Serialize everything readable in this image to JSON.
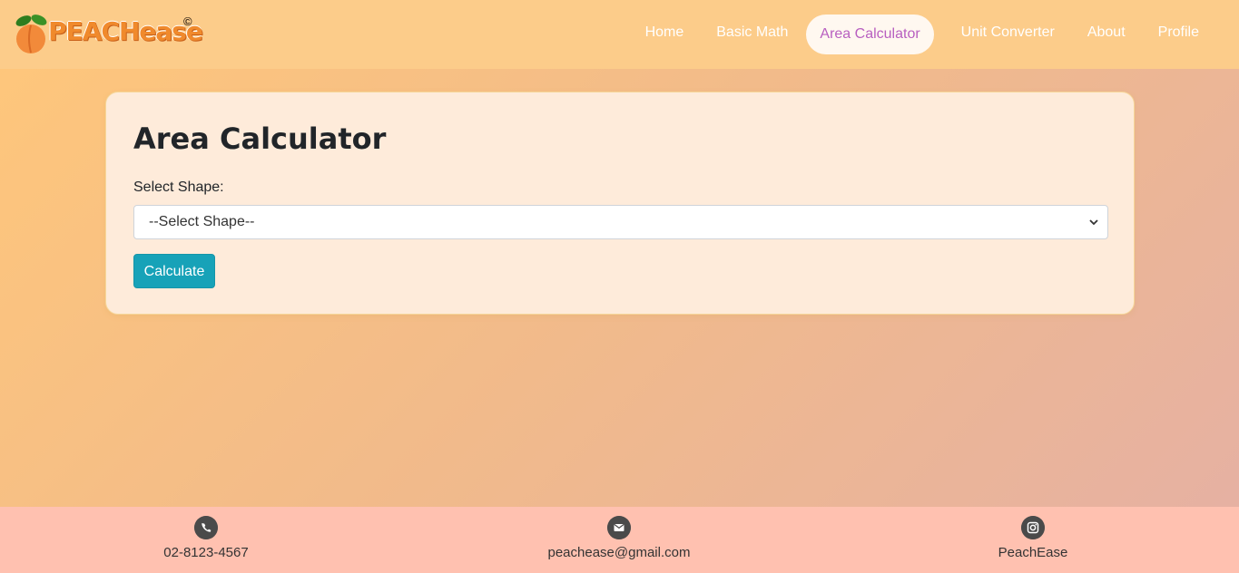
{
  "brand": {
    "name": "PEACHease",
    "copyright_mark": "©"
  },
  "nav": {
    "items": [
      {
        "label": "Home"
      },
      {
        "label": "Basic Math"
      },
      {
        "label": "Area Calculator"
      },
      {
        "label": "Unit Converter"
      },
      {
        "label": "About"
      },
      {
        "label": "Profile"
      }
    ],
    "active": "Area Calculator"
  },
  "main": {
    "title": "Area Calculator",
    "shape_label": "Select Shape:",
    "shape_select_value": "--Select Shape--",
    "calculate_label": "Calculate"
  },
  "footer": {
    "phone": {
      "icon": "phone-icon",
      "text": "02-8123-4567"
    },
    "email": {
      "icon": "mail-icon",
      "text": "peachease@gmail.com"
    },
    "instagram": {
      "icon": "instagram-icon",
      "text": "PeachEase"
    }
  },
  "colors": {
    "nav_bg": "#fccc8a",
    "active_text": "#b85fc0",
    "button": "#17a2b8",
    "footer_bg": "#ffc1b0",
    "card_bg": "#feebda"
  }
}
